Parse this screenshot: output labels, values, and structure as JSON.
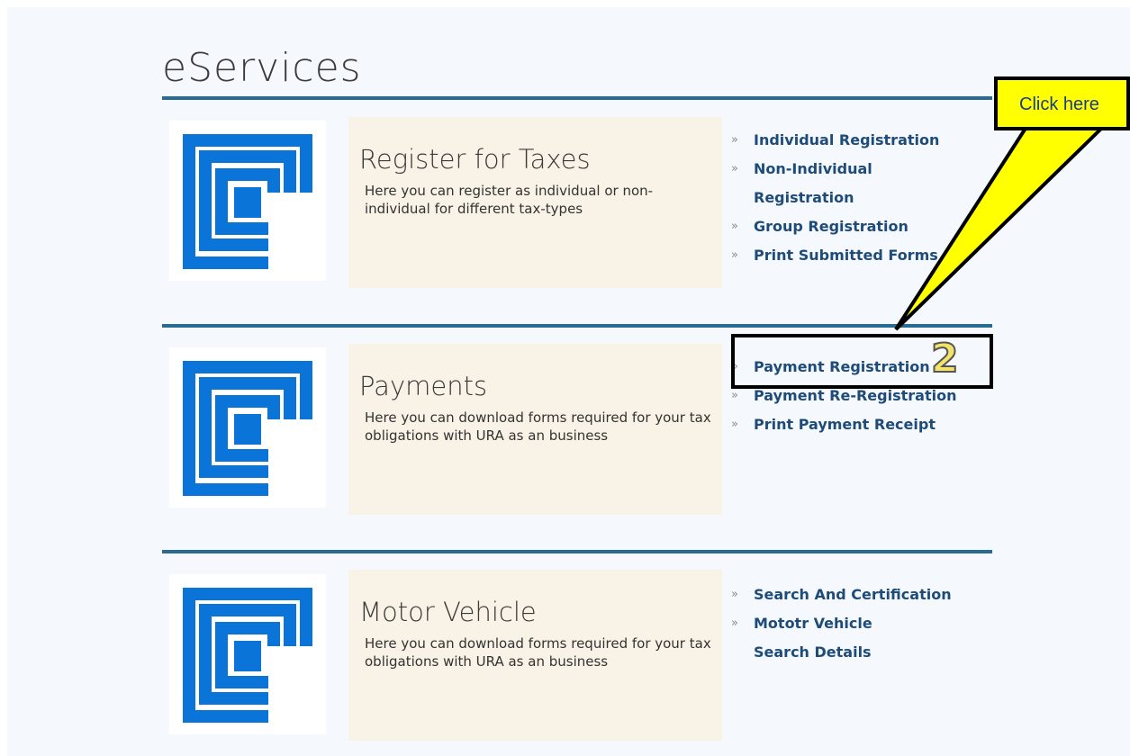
{
  "page": {
    "title": "eServices"
  },
  "sections": [
    {
      "title": "Register for Taxes",
      "description": "Here you can register as individual or non-individual for different tax-types",
      "links": [
        "Individual Registration",
        "Non-Individual Registration",
        "Group Registration",
        "Print Submitted Forms"
      ]
    },
    {
      "title": "Payments",
      "description": "Here you can download forms required for your tax obligations with URA as an business",
      "links": [
        "Payment Registration",
        "Payment Re-Registration",
        "Print Payment Receipt"
      ]
    },
    {
      "title": "Motor Vehicle",
      "description": "Here you can download forms required for your tax obligations with URA as an business",
      "links": [
        "Search And Certification",
        "Mototr Vehicle Search Details"
      ]
    }
  ],
  "bullet": "»",
  "annotation": {
    "callout_text": "Click here",
    "step_number": "2"
  },
  "colors": {
    "logo_blue": "#0a74d9",
    "rule": "#2a6b92",
    "panel": "#f9f2e6",
    "link": "#1e4b78",
    "callout": "#ffff00"
  },
  "icons": {
    "section_logo": "ura-logo-icon"
  }
}
